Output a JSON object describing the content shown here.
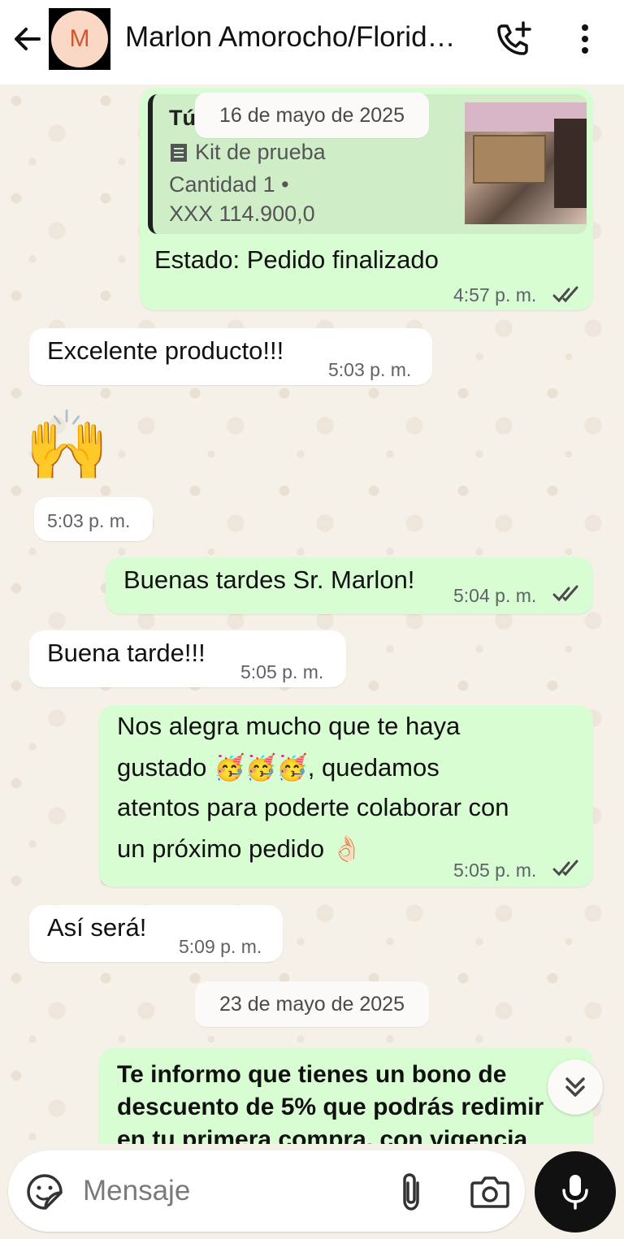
{
  "header": {
    "avatar_letter": "M",
    "contact_name": "Marlon Amorocho/Florid…"
  },
  "colors": {
    "outgoing_bubble": "#d9fdd3",
    "incoming_bubble": "#ffffff",
    "read_ticks": "#4a4a4a",
    "avatar_bg": "#fbd7c6"
  },
  "order": {
    "sender": "Tú",
    "date_chip": "16 de mayo de 2025",
    "product": "Kit de prueba",
    "quantity": "Cantidad 1 •",
    "price": "XXX 114.900,0",
    "status": "Estado: Pedido finalizado",
    "time": "4:57 p. m."
  },
  "messages": [
    {
      "text": "Excelente producto!!!",
      "time": "5:03 p. m."
    },
    {
      "emoji": "🙌",
      "time": "5:03 p. m."
    },
    {
      "text": "Buenas tardes Sr. Marlon!",
      "time": "5:04 p. m."
    },
    {
      "text": "Buena tarde!!!",
      "time": "5:05 p. m."
    },
    {
      "line1": "Nos alegra mucho que te haya",
      "line2_prefix": "gustado",
      "line2_emoji": "🥳🥳🥳",
      "line2_suffix": ", quedamos",
      "line3": "atentos para poderte colaborar con",
      "line4": "un próximo pedido",
      "line4_emoji": "👌🏻",
      "time": "5:05 p. m."
    },
    {
      "text": "Así será!",
      "time": "5:09 p. m."
    }
  ],
  "date_chip_2": "23 de mayo de 2025",
  "last_message": {
    "line1": "Te informo que tienes un bono de",
    "line2": "descuento de 5% que podrás redimir",
    "line3": "en tu primera compra, con vigencia"
  },
  "input": {
    "placeholder": "Mensaje"
  }
}
